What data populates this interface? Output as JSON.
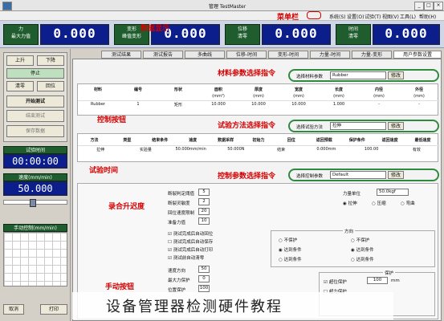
{
  "window": {
    "title": "管理 TestMaster"
  },
  "menu": [
    "系统(S)",
    "设置(O)",
    "试验(T)",
    "视图(V)",
    "工具(L)",
    "帮助(H)"
  ],
  "toolbar": {
    "group1_label_top": "力",
    "group1_label_bottom": "最大力值",
    "value1": "0.000",
    "group2_label_top": "变形",
    "group2_label_bottom": "峰值变形",
    "value2": "0.000",
    "group3_label_top": "位移",
    "group3_label_bottom": "清零",
    "value3": "0.000",
    "group4_label_top": "时间",
    "group4_label_bottom": "清零",
    "value4": "0.000"
  },
  "annotations": {
    "menu": "菜单栏",
    "display": "数据显示",
    "material": "材料参数选择指令",
    "control": "控制按钮",
    "method": "试验方法选择指令",
    "time": "试验时间",
    "speed": "录合升迟度",
    "params": "控制参数选择指令",
    "manual": "手动按钮"
  },
  "left": {
    "btn_up": "上升",
    "btn_down": "下降",
    "btn_stop": "停止",
    "btn_clear": "清零",
    "btn_return": "回位",
    "btn_start": "开始测试",
    "btn_end": "结束测试",
    "btn_save": "保存数据",
    "time_label": "试验时间",
    "time_value": "00:00:00",
    "speed_label": "速度(mm/min)",
    "speed_value": "50.000",
    "manual_label": "手动控制(mm/min)",
    "btn_cancel": "取消",
    "btn_print": "打印"
  },
  "tabs": [
    "用户参数设置",
    "力量-变形",
    "力量-时间",
    "变形-时间",
    "位移-时间",
    "多曲线",
    "测试报告",
    "测试结果"
  ],
  "material": {
    "label": "选择材料参数",
    "value": "Rubber",
    "btn": "修改",
    "headers": [
      "材料",
      "编号",
      "形状",
      "面积",
      "厚度",
      "宽度",
      "长度",
      "内径",
      "外径"
    ],
    "units": [
      "",
      "",
      "",
      "(mm²)",
      "(mm)",
      "(mm)",
      "(mm)",
      "(mm)",
      "(mm)"
    ],
    "row": [
      "Rubber",
      "1",
      "矩形",
      "10.000",
      "10.000",
      "10.000",
      "1.000",
      "-",
      "-"
    ]
  },
  "method": {
    "label": "选择试验方法",
    "value": "拉伸",
    "btn": "修改",
    "headers": [
      "方法",
      "类型",
      "结束条件",
      "速度",
      "数据采样",
      "初始力",
      "回位",
      "返回预载",
      "保护条件",
      "返回速度",
      "最低速度"
    ],
    "row": [
      "拉伸",
      "实验量",
      "50.000mm/min",
      "50.000N",
      "结束",
      "0.000mm",
      "100.00",
      "有效"
    ]
  },
  "params": {
    "label": "选择控制参数",
    "value": "Default",
    "btn": "修改",
    "f1_label": "断裂判定阈值",
    "f1_value": "5",
    "f2_label": "断裂灵敏度",
    "f2_value": "2",
    "f3_label": "回位速度限制",
    "f3_value": "20",
    "f4_label": "准备力值",
    "f4_value": "10",
    "cb1": "测试完成后自动回位",
    "cb2": "测试完成后自动保存",
    "cb3": "测试完成后自动打印",
    "cb4": "测试前自动清零",
    "speed_label": "速度方向",
    "speed_value": "50",
    "proto_label": "最大力保护",
    "proto_value": "0",
    "pos_label": "位置保护",
    "pos_value": "100",
    "unit_force": "力量单位",
    "unit_force_value": "50.0kgf",
    "dir_label": "方向",
    "radio_a": "拉伸",
    "radio_b": "压缩",
    "radio_c": "弯曲",
    "status_a": "不保护",
    "status_b": "达到条件",
    "status_c": "达到条件",
    "prot_title": "保护",
    "prot1": "超位保护",
    "prot2": "超力保护",
    "prot_value": "100",
    "prot_unit": "mm"
  },
  "caption": "设备管理器检测硬件教程"
}
